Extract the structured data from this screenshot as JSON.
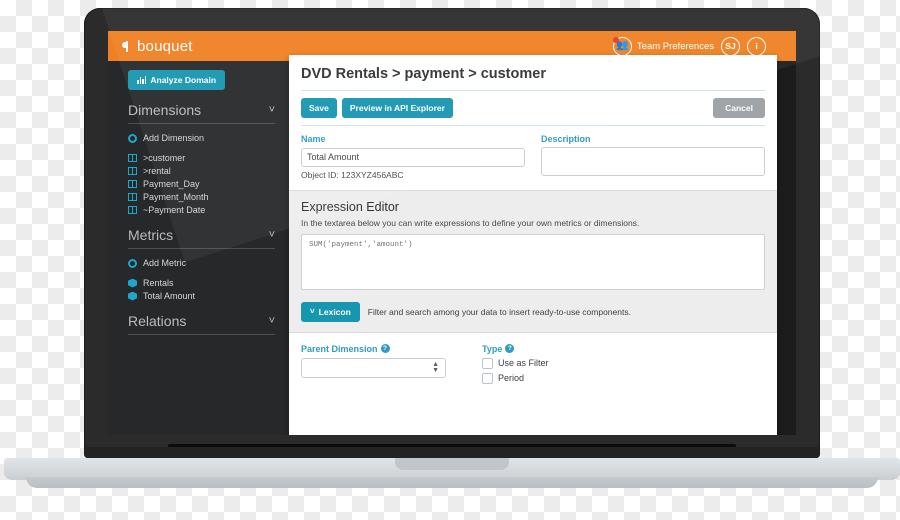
{
  "app": {
    "brand": "bouquet",
    "brand_icon": "bouquet-logo-icon",
    "accent_orange": "#f08122",
    "accent_teal": "#1796b0",
    "accent_blue": "#2d9cc4"
  },
  "topbar": {
    "team_preferences_label": "Team Preferences",
    "team_icon": "team-icon",
    "notification_dot": "notification-dot",
    "avatar_initials": "SJ",
    "info_label": "i"
  },
  "sidebar": {
    "analyze_button": "Analyze Domain",
    "analyze_icon": "bar-chart-icon",
    "sections": [
      {
        "title": "Dimensions",
        "chevron": "˅",
        "add_label": "Add Dimension",
        "items": [
          ">customer",
          ">rental",
          "Payment_Day",
          "Payment_Month",
          "~Payment Date"
        ]
      },
      {
        "title": "Metrics",
        "chevron": "˅",
        "add_label": "Add Metric",
        "items": [
          "Rentals",
          "Total Amount"
        ]
      },
      {
        "title": "Relations",
        "chevron": "˅"
      }
    ]
  },
  "panel": {
    "title": "DVD Rentals > payment > customer",
    "buttons": {
      "save": "Save",
      "preview": "Preview in API Explorer",
      "cancel": "Cancel"
    },
    "name_field": {
      "label": "Name",
      "value": "Total Amount",
      "placeholder": "Name"
    },
    "object_id": "Object ID: 123XYZ456ABC",
    "description_field": {
      "label": "Description",
      "value": "",
      "placeholder": ""
    },
    "expression_editor": {
      "title": "Expression Editor",
      "subtitle": "In the textarea below you can write expressions to define your own metrics or dimensions.",
      "expression": "SUM('payment','amount')",
      "lexicon_button": "Lexicon",
      "lexicon_chevron": "˅",
      "lexicon_hint": "Filter and search among your data to insert ready-to-use components."
    },
    "parent_dimension": {
      "label": "Parent Dimension",
      "help": "?",
      "value": "",
      "options": [
        ""
      ]
    },
    "type": {
      "label": "Type",
      "help": "?",
      "checkboxes": [
        {
          "label": "Use as Filter",
          "checked": false
        },
        {
          "label": "Period",
          "checked": false
        }
      ]
    }
  }
}
